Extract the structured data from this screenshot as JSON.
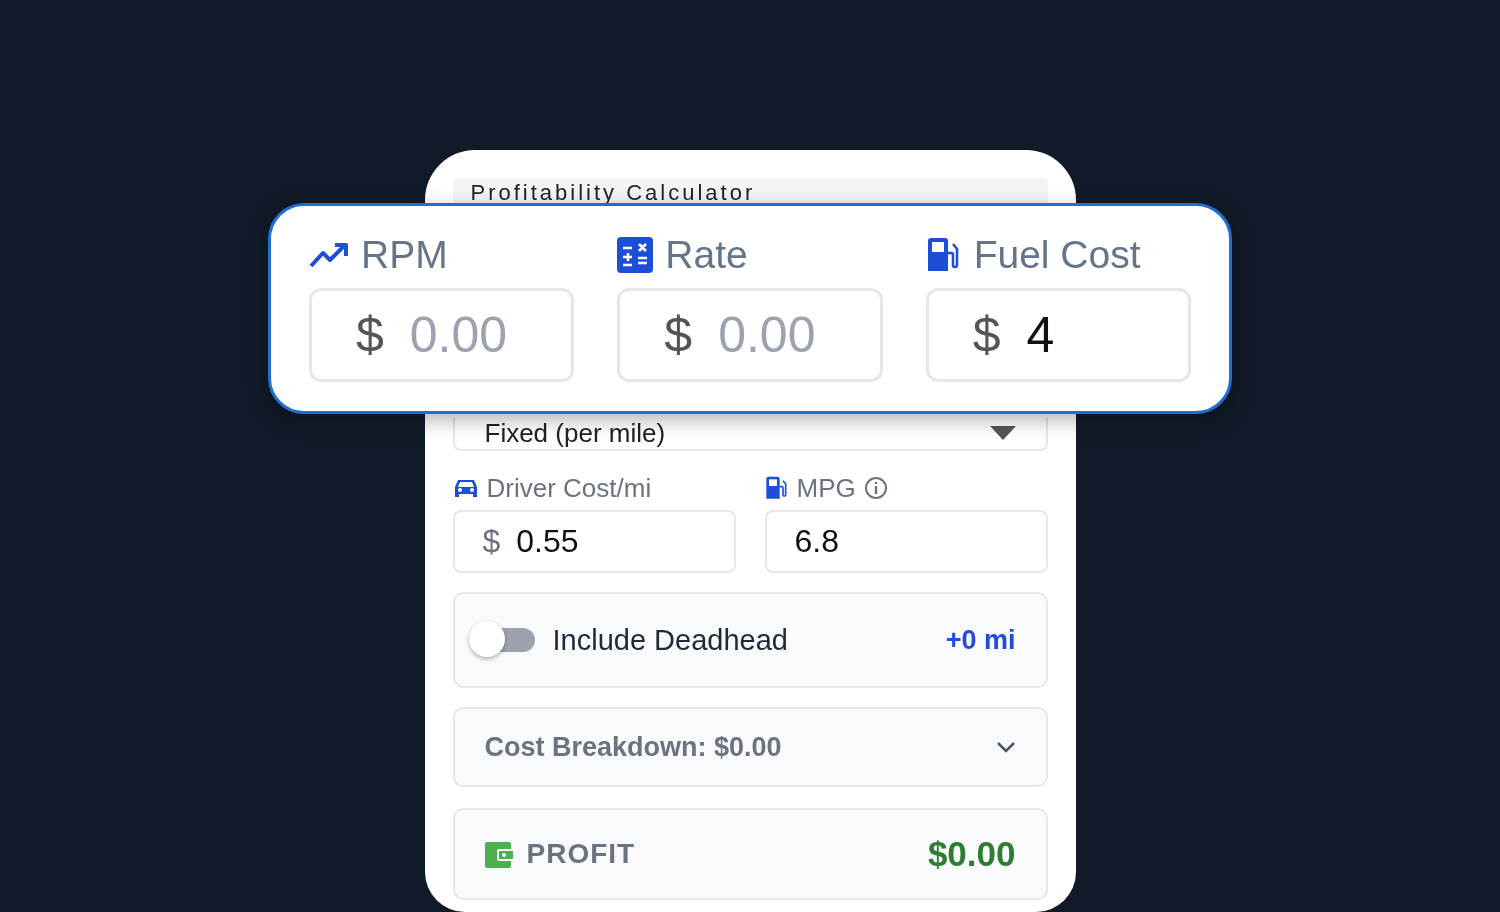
{
  "card": {
    "title": "Profitability Calculator",
    "mode_select": {
      "value": "Fixed (per mile)"
    },
    "driver_cost": {
      "label": "Driver Cost/mi",
      "prefix": "$",
      "value": "0.55"
    },
    "mpg": {
      "label": "MPG",
      "value": "6.8"
    },
    "deadhead": {
      "label": "Include Deadhead",
      "on": false,
      "miles": "+0 mi"
    },
    "cost_breakdown": {
      "label": "Cost Breakdown: $0.00",
      "expanded": false
    },
    "profit": {
      "label": "PROFIT",
      "value": "$0.00"
    }
  },
  "highlight": {
    "fields": [
      {
        "label": "RPM",
        "prefix": "$",
        "placeholder": "0.00"
      },
      {
        "label": "Rate",
        "prefix": "$",
        "placeholder": "0.00"
      },
      {
        "label": "Fuel Cost",
        "prefix": "$",
        "value": "4"
      }
    ]
  }
}
